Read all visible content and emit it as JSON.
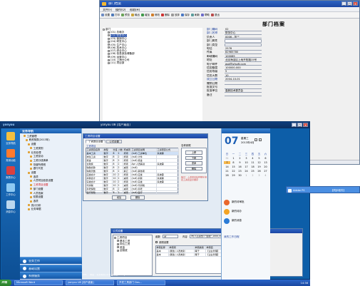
{
  "window1": {
    "title": "部门档案",
    "menu": [
      "文件(F)",
      "操作(O)",
      "帮助(H)"
    ],
    "toolbar": [
      "设置",
      "打印",
      "预览",
      "输出",
      "增加",
      "修改",
      "删除",
      "放弃",
      "保存",
      "刷新",
      "帮助",
      "退出"
    ],
    "heading": "部门档案",
    "tree": [
      {
        "label": "部门",
        "indent": 0
      },
      {
        "label": "(01) 总裁办",
        "indent": 1
      },
      {
        "label": "(02) 财务中心",
        "indent": 1,
        "selected": true
      },
      {
        "label": "(03) 营销中心",
        "indent": 1
      },
      {
        "label": "(04) 研发中心",
        "indent": 1
      },
      {
        "label": "(05) 生产中心",
        "indent": 1
      },
      {
        "label": "(06) 技术中心",
        "indent": 1
      },
      {
        "label": "(07) 综合中心",
        "indent": 1
      },
      {
        "label": "(08) 信息部及储备部",
        "indent": 1
      },
      {
        "label": "(09) 运营中心",
        "indent": 1
      },
      {
        "label": "(10) 上海分公司",
        "indent": 1
      },
      {
        "label": "(11) 项目部",
        "indent": 1
      }
    ],
    "fields": [
      {
        "label": "部门编码",
        "value": "02",
        "blue": true
      },
      {
        "label": "部门名称",
        "value": "财务中心",
        "blue": true
      },
      {
        "label": "负责人",
        "value": "0006 - 张三"
      },
      {
        "label": "部门属性",
        "value": ""
      },
      {
        "label": "部门类型",
        "value": ""
      },
      {
        "label": "电话",
        "value": "2578"
      },
      {
        "label": "传真",
        "value": "82985780"
      },
      {
        "label": "邮政编码",
        "value": "100085"
      },
      {
        "label": "地址",
        "value": "北京海淀区上地开拓路15号"
      },
      {
        "label": "电子邮件",
        "value": "gsd@ufsoft.com"
      },
      {
        "label": "信用额度",
        "value": "100000.000"
      },
      {
        "label": "信用等级",
        "value": "5"
      },
      {
        "label": "信用天数",
        "value": "10"
      },
      {
        "label": "成立日期",
        "value": "2004-10-01",
        "blue": true
      },
      {
        "label": "撤销日期",
        "value": ""
      },
      {
        "label": "批准文号",
        "value": ""
      },
      {
        "label": "批准单位",
        "value": "高新技术委员会"
      },
      {
        "label": "备注",
        "value": ""
      }
    ]
  },
  "window2": {
    "title": "yonyou U8 [用户桌面]",
    "nav": [
      {
        "label": "业务导航",
        "color": "#f3c040"
      },
      {
        "label": "常用功能",
        "color": "#ff7a2e"
      },
      {
        "label": "报表中心",
        "color": "#d94040"
      },
      {
        "label": "工作中心",
        "color": "#8ec9f2"
      },
      {
        "label": "消息中心",
        "color": "#bcd7ee"
      }
    ],
    "side_title": "业务导航",
    "side_items": [
      {
        "label": "工资管理",
        "indent": 1
      },
      {
        "label": "薪资核算(2013年)",
        "indent": 2
      },
      {
        "label": "设置",
        "indent": 3
      },
      {
        "label": "工资类别",
        "indent": 4
      },
      {
        "label": "业务处理",
        "indent": 3
      },
      {
        "label": "工资变动",
        "indent": 4
      },
      {
        "label": "工资分钱清单",
        "indent": 4
      },
      {
        "label": "扣缴所得税",
        "indent": 4
      },
      {
        "label": "银行代发",
        "indent": 4
      },
      {
        "label": "设置",
        "indent": 3
      },
      {
        "label": "选项",
        "indent": 4
      },
      {
        "label": "人员附加信息设置",
        "indent": 4
      },
      {
        "label": "工资项目设置",
        "indent": 4,
        "selected": true
      },
      {
        "label": "部门设置",
        "indent": 4
      },
      {
        "label": "人员档案",
        "indent": 4
      },
      {
        "label": "权限设置",
        "indent": 4
      },
      {
        "label": "选项",
        "indent": 4
      },
      {
        "label": "统计分析",
        "indent": 3
      },
      {
        "label": "业务单据",
        "indent": 3
      }
    ],
    "side_bottom": [
      "业务工作",
      "基础设置",
      "系统服务"
    ],
    "dialog1": {
      "title": "工资项目设置",
      "tabs": [
        "工资项目设置",
        "公式设置"
      ],
      "section": "工资项目",
      "columns": [
        "工资项目名称",
        "类型",
        "长度",
        "小数",
        "增减项",
        "工资项目说明",
        "工资项目公式"
      ],
      "rows": [
        [
          "基本工资",
          "数字",
          "8",
          "2",
          "增项",
          "(null) 工资单位",
          "系统需"
        ],
        [
          "岗位工资",
          "数字",
          "8",
          "2",
          "增项",
          "(null) 计件",
          ""
        ],
        [
          "奖金",
          "数字",
          "8",
          "2",
          "增项",
          "(null) 奖金",
          ""
        ],
        [
          "全勤奖",
          "数字",
          "8",
          "2",
          "增项",
          "Apr 人员薪资",
          "系统需"
        ],
        [
          "缺勤扣款",
          "数字",
          "8",
          "2",
          "减项",
          "(null)",
          ""
        ],
        [
          "缺勤天数",
          "数字",
          "8",
          "2",
          "其它",
          "(null) 其他项",
          ""
        ],
        [
          "应发合计",
          "数字",
          "10",
          "2",
          "增项",
          "(null) 应发",
          "系统需"
        ],
        [
          "扣款合计",
          "数字",
          "10",
          "2",
          "减项",
          "(null) 扣款",
          "系统需"
        ],
        [
          "实发合计",
          "数字",
          "10",
          "2",
          "增项",
          "(null) 实发",
          "系统需"
        ],
        [
          "代扣税",
          "数字",
          "10",
          "2",
          "减项",
          "(null) 代扣税",
          ""
        ],
        [
          "养老保险",
          "数字",
          "8",
          "2",
          "减项",
          "(null) 养老",
          ""
        ],
        [
          "医疗保险",
          "数字",
          "8",
          "2",
          "减项",
          "(null) 医疗",
          ""
        ]
      ],
      "right_title": "名称参照",
      "right_buttons": [
        "上移",
        "下移",
        "重命",
        "删除"
      ],
      "hint": "提示：工资项目名称顺序决定工资表显示顺序",
      "bottom_buttons": [
        "增加",
        "删除"
      ]
    },
    "dialog2": {
      "title": "公式设置",
      "tree": [
        "工资项目",
        "基本工资",
        "岗位工资",
        "奖金",
        "全勤奖"
      ],
      "func_label": "函数",
      "func_value": "iff",
      "cond_label": "内容",
      "cond_value": "iff(人员类别=\"经理\",1000,500)",
      "check_label": "参照设置",
      "table_head": [
        "参照名称",
        "参照项",
        "参照类别",
        "参照值"
      ],
      "table_rows": [
        [
          "基本",
          "(属性) 人员类别",
          "等于",
          "【企业管理】"
        ],
        [
          "基本",
          "(属性) 人员类别",
          "等于",
          "【企业管理】"
        ]
      ]
    },
    "calendar": {
      "day": "07",
      "weekday": "星期三",
      "month": "2013年4月",
      "weekdays": [
        "日",
        "一",
        "二",
        "三",
        "四",
        "五",
        "六"
      ],
      "dates": [
        "31",
        "1",
        "2",
        "3",
        "4",
        "5",
        "6",
        "7",
        "8",
        "9",
        "10",
        "11",
        "12",
        "13",
        "14",
        "15",
        "16",
        "17",
        "18",
        "19",
        "20",
        "21",
        "22",
        "23",
        "24",
        "25",
        "26",
        "27",
        "28",
        "29",
        "30",
        "1",
        "2",
        "3",
        "4"
      ],
      "today_index": 7,
      "todos": [
        {
          "label": "新的待审批",
          "color": "#e9682e"
        },
        {
          "label": "新的待办",
          "color": "#f3a426"
        },
        {
          "label": "新的消息",
          "color": "#2a7bd6"
        }
      ],
      "footer": "我的工作日程"
    },
    "status": "U8C - 消息 - 北京软件(华东) 账套[2013] 2013-04-07"
  },
  "taskbar": {
    "start": "开始",
    "tasks": [
      "Microsoft Word",
      "yonyou U8 [用户桌面]",
      "开发工具部门 Des..."
    ],
    "time": "14:36"
  },
  "tray": {
    "label": "Adobe PS",
    "status": "【同步软件】"
  }
}
